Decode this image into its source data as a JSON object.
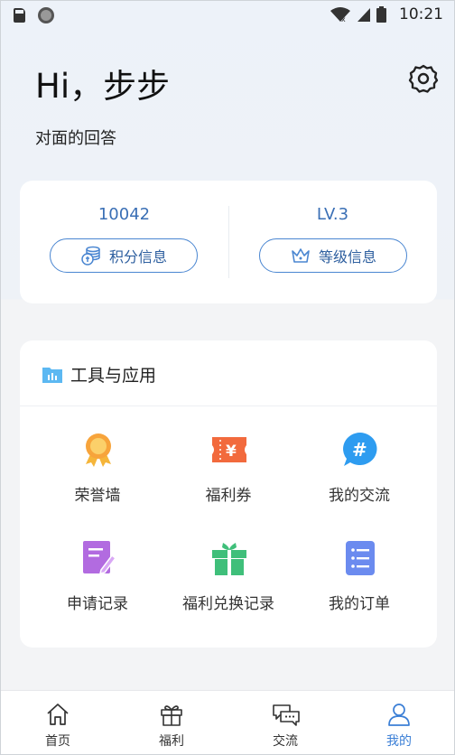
{
  "status_bar": {
    "time": "10:21"
  },
  "header": {
    "greeting": "Hi，步步",
    "subtitle": "对面的回答"
  },
  "stats": {
    "points": {
      "value": "10042",
      "button_label": "积分信息"
    },
    "level": {
      "value": "LV.3",
      "button_label": "等级信息"
    }
  },
  "tools": {
    "title": "工具与应用",
    "items": [
      {
        "label": "荣誉墙",
        "icon": "medal-icon"
      },
      {
        "label": "福利券",
        "icon": "coupon-icon"
      },
      {
        "label": "我的交流",
        "icon": "hashtag-chat-icon"
      },
      {
        "label": "申请记录",
        "icon": "edit-document-icon"
      },
      {
        "label": "福利兑换记录",
        "icon": "gift-box-icon"
      },
      {
        "label": "我的订单",
        "icon": "list-icon"
      }
    ]
  },
  "bottom_nav": {
    "items": [
      {
        "label": "首页",
        "icon": "home-icon"
      },
      {
        "label": "福利",
        "icon": "gift-icon"
      },
      {
        "label": "交流",
        "icon": "chat-icon"
      },
      {
        "label": "我的",
        "icon": "person-icon",
        "active": true
      }
    ]
  },
  "colors": {
    "accent": "#3b7fd6",
    "card": "#ffffff",
    "background": "#f3f4f6"
  }
}
